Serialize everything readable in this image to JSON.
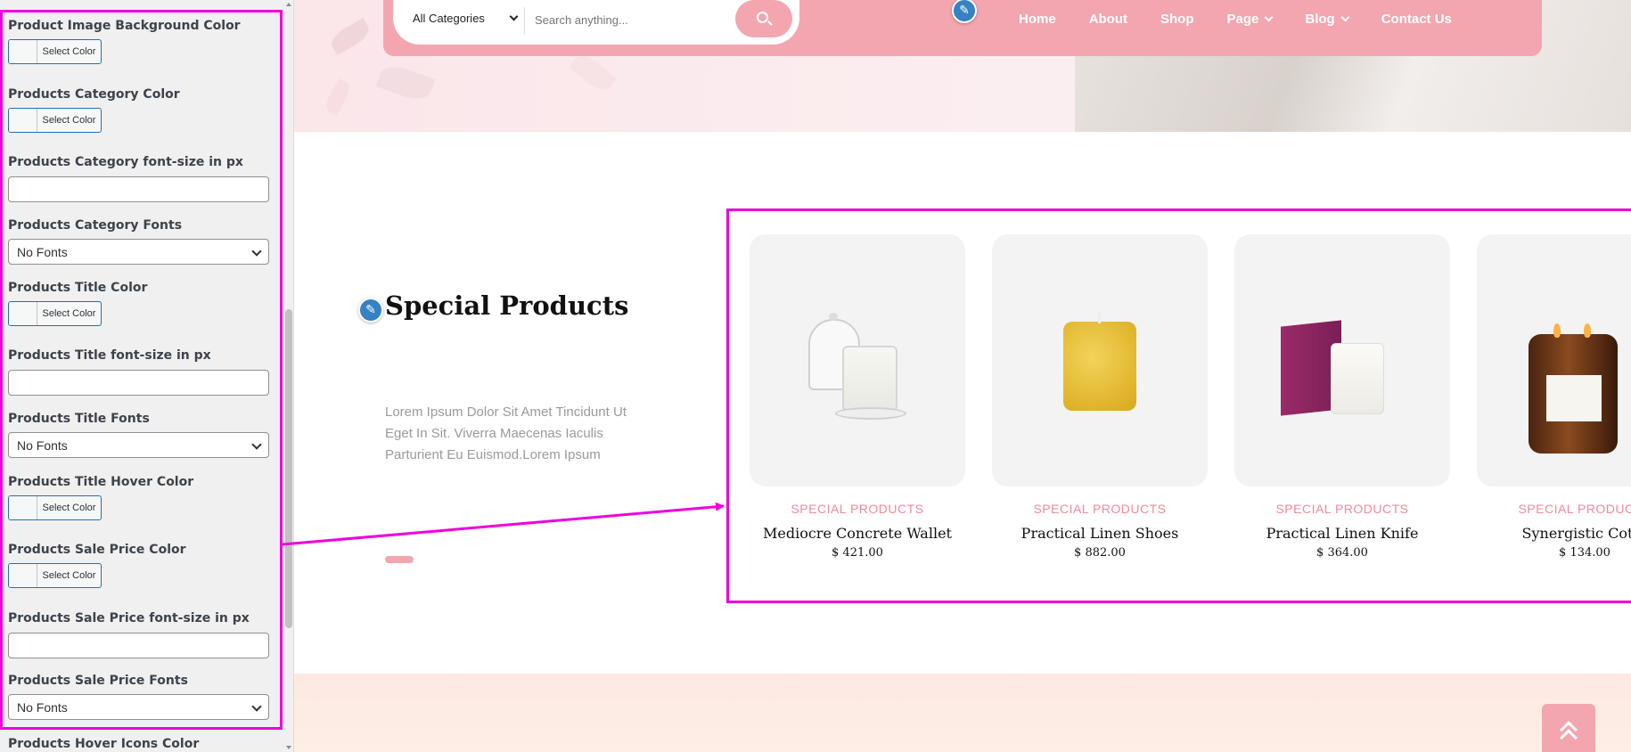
{
  "panel": {
    "controls": [
      {
        "type": "color",
        "label": "Product Image Background Color",
        "button": "Select Color"
      },
      {
        "type": "color",
        "label": "Products Category Color",
        "button": "Select Color"
      },
      {
        "type": "text",
        "label": "Products Category font-size in px",
        "value": ""
      },
      {
        "type": "select",
        "label": "Products Category Fonts",
        "value": "No Fonts"
      },
      {
        "type": "color",
        "label": "Products Title Color",
        "button": "Select Color"
      },
      {
        "type": "text",
        "label": "Products Title font-size in px",
        "value": ""
      },
      {
        "type": "select",
        "label": "Products Title Fonts",
        "value": "No Fonts"
      },
      {
        "type": "color",
        "label": "Products Title Hover Color",
        "button": "Select Color"
      },
      {
        "type": "color",
        "label": "Products Sale Price Color",
        "button": "Select Color"
      },
      {
        "type": "text",
        "label": "Products Sale Price font-size in px",
        "value": ""
      },
      {
        "type": "select",
        "label": "Products Sale Price Fonts",
        "value": "No Fonts"
      },
      {
        "type": "label",
        "label": "Products Hover Icons Color"
      }
    ]
  },
  "header": {
    "category_select": "All Categories",
    "search_placeholder": "Search anything...",
    "nav": [
      {
        "label": "Home",
        "dropdown": false
      },
      {
        "label": "About",
        "dropdown": false
      },
      {
        "label": "Shop",
        "dropdown": false
      },
      {
        "label": "Page",
        "dropdown": true
      },
      {
        "label": "Blog",
        "dropdown": true
      },
      {
        "label": "Contact Us",
        "dropdown": false
      }
    ]
  },
  "special": {
    "title": "Special Products",
    "description": "Lorem Ipsum Dolor Sit Amet Tincidunt Ut Eget In Sit. Viverra Maecenas Iaculis Parturient Eu Euismod.Lorem Ipsum"
  },
  "products": [
    {
      "category": "SPECIAL PRODUCTS",
      "name": "Mediocre Concrete Wallet",
      "price": "$ 421.00",
      "image": "candle-glass-dome"
    },
    {
      "category": "SPECIAL PRODUCTS",
      "name": "Practical Linen Shoes",
      "price": "$ 882.00",
      "image": "candle-yellow-pillar"
    },
    {
      "category": "SPECIAL PRODUCTS",
      "name": "Practical Linen Knife",
      "price": "$ 364.00",
      "image": "candle-box-jar"
    },
    {
      "category": "SPECIAL PRODUCTS",
      "name": "Synergistic Cotto",
      "price": "$ 134.00",
      "image": "candle-amber-jar"
    }
  ],
  "colors": {
    "accent_pink": "#f3a6b0",
    "category_pink": "#f18a9b",
    "highlight_magenta": "#ee00dd",
    "wp_blue": "#2271b1"
  }
}
